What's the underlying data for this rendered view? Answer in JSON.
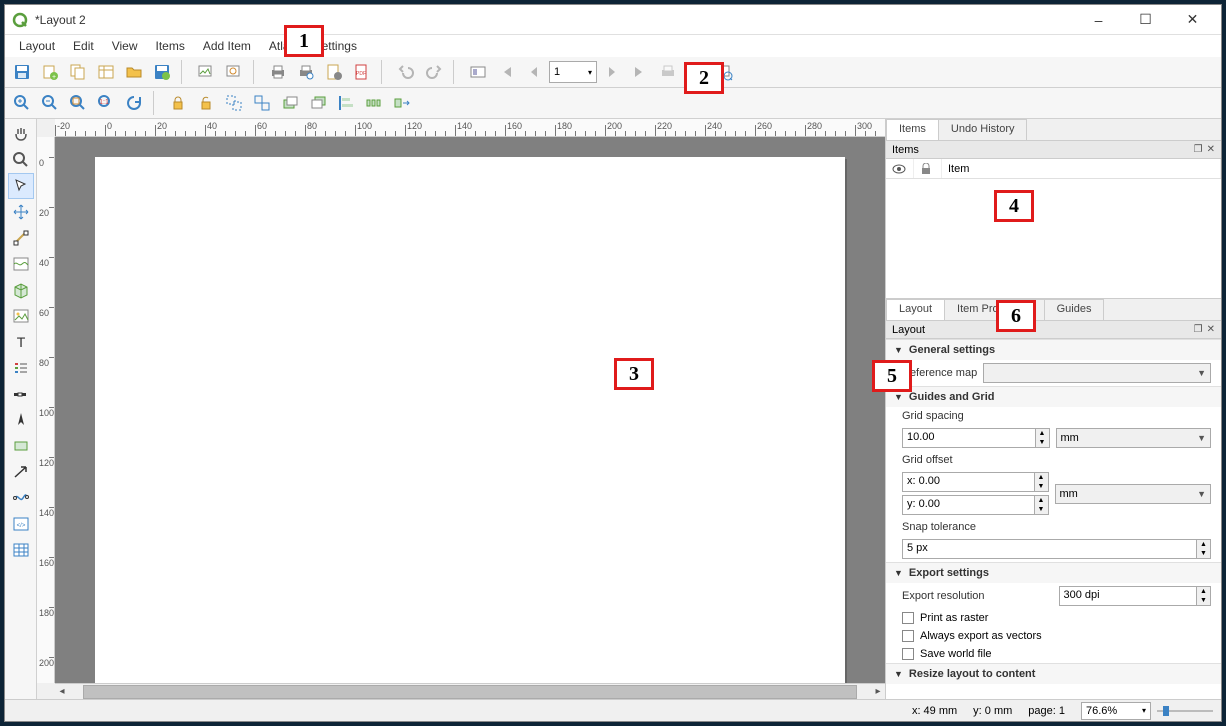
{
  "window": {
    "title": "*Layout 2"
  },
  "menu": {
    "items": [
      "Layout",
      "Edit",
      "View",
      "Items",
      "Add Item",
      "Atlas",
      "Settings"
    ]
  },
  "toolbar": {
    "page_number": "1"
  },
  "ruler": {
    "h_ticks": [
      "-20",
      "0",
      "20",
      "40",
      "60",
      "80",
      "100",
      "120",
      "140",
      "160",
      "180",
      "200",
      "220",
      "240",
      "260",
      "280",
      "300"
    ],
    "v_ticks": [
      "0",
      "20",
      "40",
      "60",
      "80",
      "100",
      "120",
      "140",
      "160",
      "180",
      "200"
    ]
  },
  "panels": {
    "top_tabs": {
      "items": "Items",
      "undo": "Undo History"
    },
    "items_panel": {
      "title": "Items",
      "col_item": "Item"
    },
    "prop_tabs": {
      "layout": "Layout",
      "item_props": "Item Properties",
      "guides": "Guides"
    },
    "layout_panel_title": "Layout"
  },
  "layout_props": {
    "general": {
      "title": "General settings",
      "ref_map_label": "Reference map",
      "ref_map_value": ""
    },
    "guides": {
      "title": "Guides and Grid",
      "spacing_label": "Grid spacing",
      "spacing_value": "10.00",
      "spacing_unit": "mm",
      "offset_label": "Grid offset",
      "offset_x": "x: 0.00",
      "offset_y": "y: 0.00",
      "offset_unit": "mm",
      "snap_label": "Snap tolerance",
      "snap_value": "5 px"
    },
    "export": {
      "title": "Export settings",
      "res_label": "Export resolution",
      "res_value": "300 dpi",
      "raster": "Print as raster",
      "vectors": "Always export as vectors",
      "world": "Save world file"
    },
    "resize": {
      "title": "Resize layout to content"
    }
  },
  "status": {
    "x_label": "x: 49 mm",
    "y_label": "y: 0 mm",
    "page_label": "page: 1",
    "zoom": "76.6%"
  },
  "callouts": {
    "c1": "1",
    "c2": "2",
    "c3": "3",
    "c4": "4",
    "c5": "5",
    "c6": "6"
  }
}
